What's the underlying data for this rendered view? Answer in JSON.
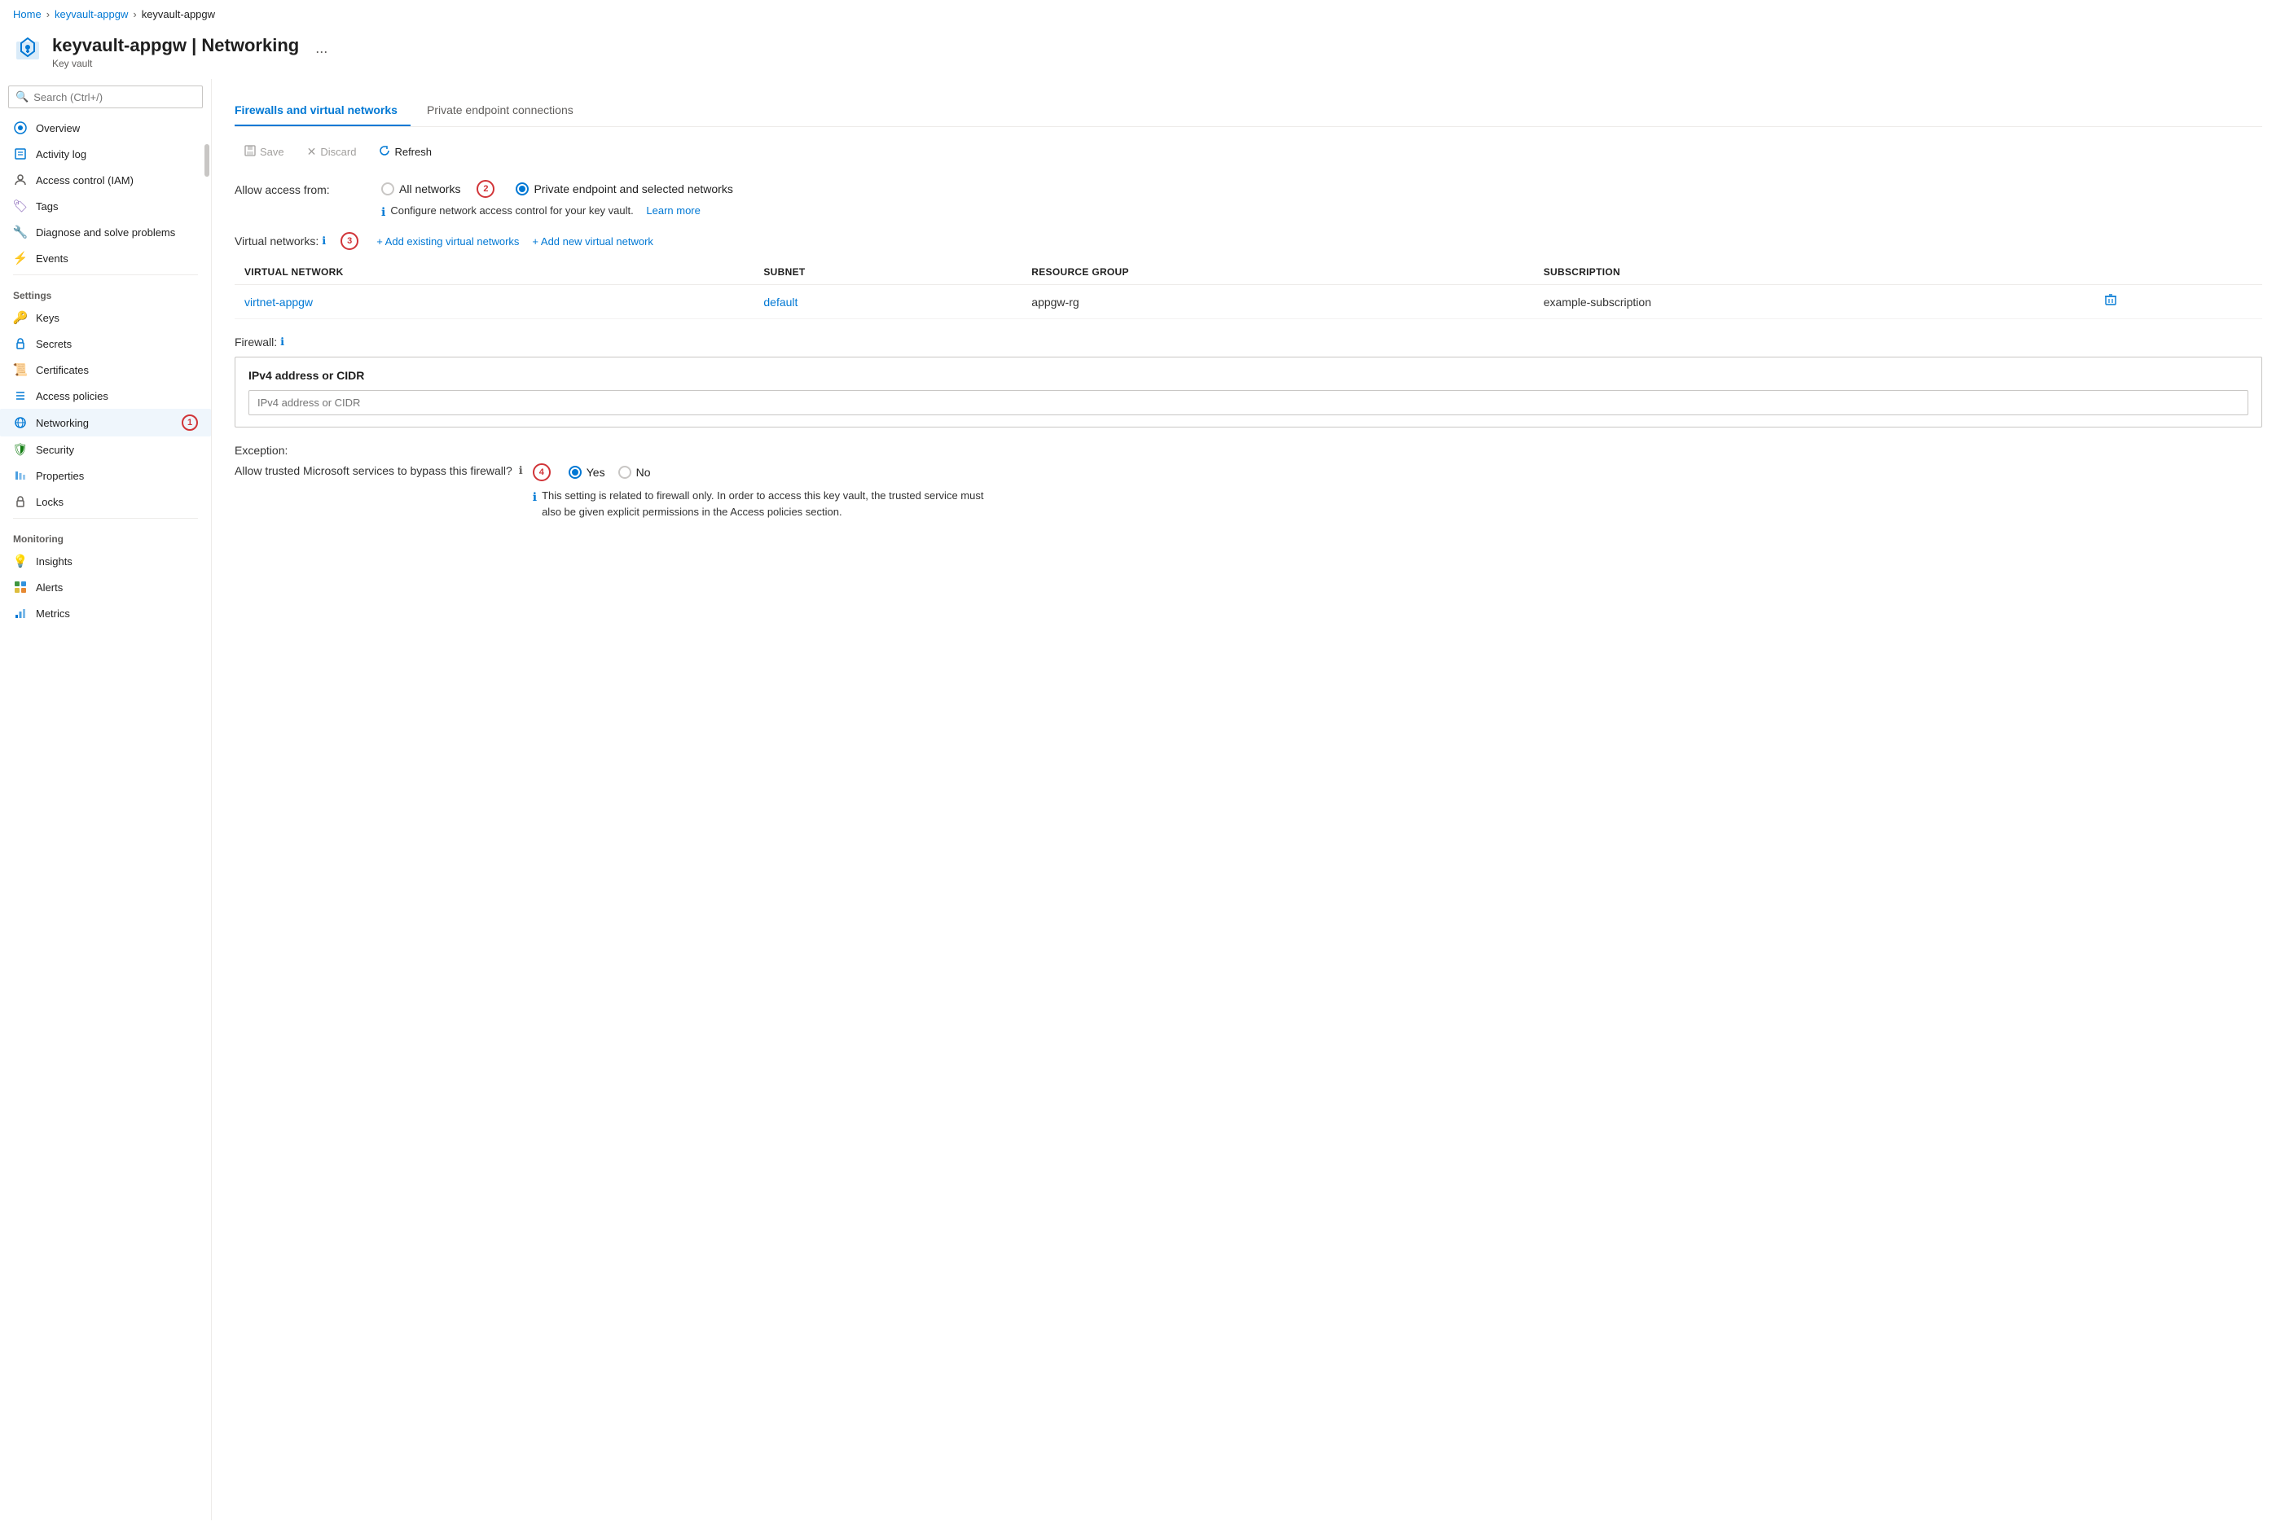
{
  "breadcrumb": {
    "home": "Home",
    "resource1": "keyvault-appgw",
    "resource2": "keyvault-appgw"
  },
  "header": {
    "title": "keyvault-appgw | Networking",
    "subtitle": "Key vault",
    "ellipsis": "..."
  },
  "search": {
    "placeholder": "Search (Ctrl+/)"
  },
  "sidebar": {
    "items": [
      {
        "id": "overview",
        "label": "Overview",
        "icon": "⊙",
        "iconColor": "#0078d4"
      },
      {
        "id": "activity-log",
        "label": "Activity log",
        "icon": "📋",
        "iconColor": "#0078d4"
      },
      {
        "id": "access-control",
        "label": "Access control (IAM)",
        "icon": "👤",
        "iconColor": "#605e5c"
      },
      {
        "id": "tags",
        "label": "Tags",
        "icon": "🏷",
        "iconColor": "#8764b8"
      },
      {
        "id": "diagnose",
        "label": "Diagnose and solve problems",
        "icon": "🔧",
        "iconColor": "#605e5c"
      },
      {
        "id": "events",
        "label": "Events",
        "icon": "⚡",
        "iconColor": "#d4ac0d"
      }
    ],
    "settings_label": "Settings",
    "settings_items": [
      {
        "id": "keys",
        "label": "Keys",
        "icon": "🔑",
        "iconColor": "#d4ac0d"
      },
      {
        "id": "secrets",
        "label": "Secrets",
        "icon": "🔒",
        "iconColor": "#0078d4"
      },
      {
        "id": "certificates",
        "label": "Certificates",
        "icon": "📜",
        "iconColor": "#e06c00"
      },
      {
        "id": "access-policies",
        "label": "Access policies",
        "icon": "≡",
        "iconColor": "#0078d4"
      },
      {
        "id": "networking",
        "label": "Networking",
        "icon": "⟳",
        "iconColor": "#0078d4",
        "badge": "1",
        "active": true
      },
      {
        "id": "security",
        "label": "Security",
        "icon": "🛡",
        "iconColor": "#107c10"
      },
      {
        "id": "properties",
        "label": "Properties",
        "icon": "|||",
        "iconColor": "#0078d4"
      },
      {
        "id": "locks",
        "label": "Locks",
        "icon": "🔒",
        "iconColor": "#605e5c"
      }
    ],
    "monitoring_label": "Monitoring",
    "monitoring_items": [
      {
        "id": "insights",
        "label": "Insights",
        "icon": "💡",
        "iconColor": "#8764b8"
      },
      {
        "id": "alerts",
        "label": "Alerts",
        "icon": "📊",
        "iconColor": "#107c10"
      },
      {
        "id": "metrics",
        "label": "Metrics",
        "icon": "⬛",
        "iconColor": "#0078d4"
      }
    ]
  },
  "tabs": [
    {
      "id": "firewalls",
      "label": "Firewalls and virtual networks",
      "active": true
    },
    {
      "id": "private-endpoints",
      "label": "Private endpoint connections",
      "active": false
    }
  ],
  "toolbar": {
    "save": "Save",
    "discard": "Discard",
    "refresh": "Refresh"
  },
  "form": {
    "allow_access_label": "Allow access from:",
    "all_networks_label": "All networks",
    "private_endpoint_label": "Private endpoint and selected networks",
    "info_text": "Configure network access control for your key vault.",
    "learn_more": "Learn more",
    "step2_badge": "2",
    "vnet_label": "Virtual networks:",
    "step3_badge": "3",
    "add_existing_label": "+ Add existing virtual networks",
    "add_new_label": "+ Add new virtual network",
    "table_headers": {
      "virtual_network": "VIRTUAL NETWORK",
      "subnet": "SUBNET",
      "resource_group": "RESOURCE GROUP",
      "subscription": "SUBSCRIPTION"
    },
    "table_rows": [
      {
        "virtual_network": "virtnet-appgw",
        "subnet": "default",
        "resource_group": "appgw-rg",
        "subscription": "example-subscription"
      }
    ],
    "firewall_label": "Firewall:",
    "ipv4_title": "IPv4 address or CIDR",
    "ipv4_placeholder": "IPv4 address or CIDR",
    "exception_label": "Exception:",
    "exception_question": "Allow trusted Microsoft services to bypass this firewall?",
    "step4_badge": "4",
    "yes_label": "Yes",
    "no_label": "No",
    "info_message": "This setting is related to firewall only. In order to access this key vault, the trusted service must also be given explicit permissions in the Access policies section."
  }
}
